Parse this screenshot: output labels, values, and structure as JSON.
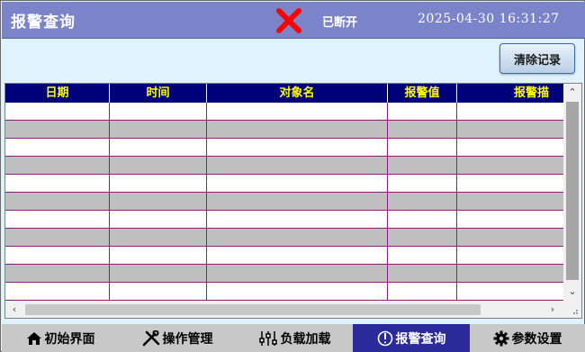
{
  "header": {
    "title": "报警查询",
    "status_icon": "disconnected-x-icon",
    "status_color": "#ff0000",
    "status_text": "已断开",
    "datetime": "2025-04-30  16:31:27"
  },
  "toolbar": {
    "clear_label": "清除记录"
  },
  "table": {
    "columns": [
      "日期",
      "时间",
      "对象名",
      "报警值",
      "报警描"
    ],
    "rows": [
      [
        "",
        "",
        "",
        "",
        ""
      ],
      [
        "",
        "",
        "",
        "",
        ""
      ],
      [
        "",
        "",
        "",
        "",
        ""
      ],
      [
        "",
        "",
        "",
        "",
        ""
      ],
      [
        "",
        "",
        "",
        "",
        ""
      ],
      [
        "",
        "",
        "",
        "",
        ""
      ],
      [
        "",
        "",
        "",
        "",
        ""
      ],
      [
        "",
        "",
        "",
        "",
        ""
      ],
      [
        "",
        "",
        "",
        "",
        ""
      ],
      [
        "",
        "",
        "",
        "",
        ""
      ],
      [
        "",
        "",
        "",
        "",
        ""
      ]
    ]
  },
  "nav": {
    "items": [
      {
        "label": "初始界面",
        "icon": "home-icon"
      },
      {
        "label": "操作管理",
        "icon": "tools-icon"
      },
      {
        "label": "负载加载",
        "icon": "sliders-icon"
      },
      {
        "label": "报警查询",
        "icon": "alarm-icon"
      },
      {
        "label": "参数设置",
        "icon": "gear-icon"
      }
    ],
    "active_index": 3
  },
  "colors": {
    "header_bg": "#7b84c8",
    "table_header_bg": "#00007a",
    "table_header_text": "#ffff00",
    "row_alt_bg": "#c0c0c0",
    "grid_line": "#8b1a8b",
    "nav_active_bg": "#2a2a9a"
  }
}
